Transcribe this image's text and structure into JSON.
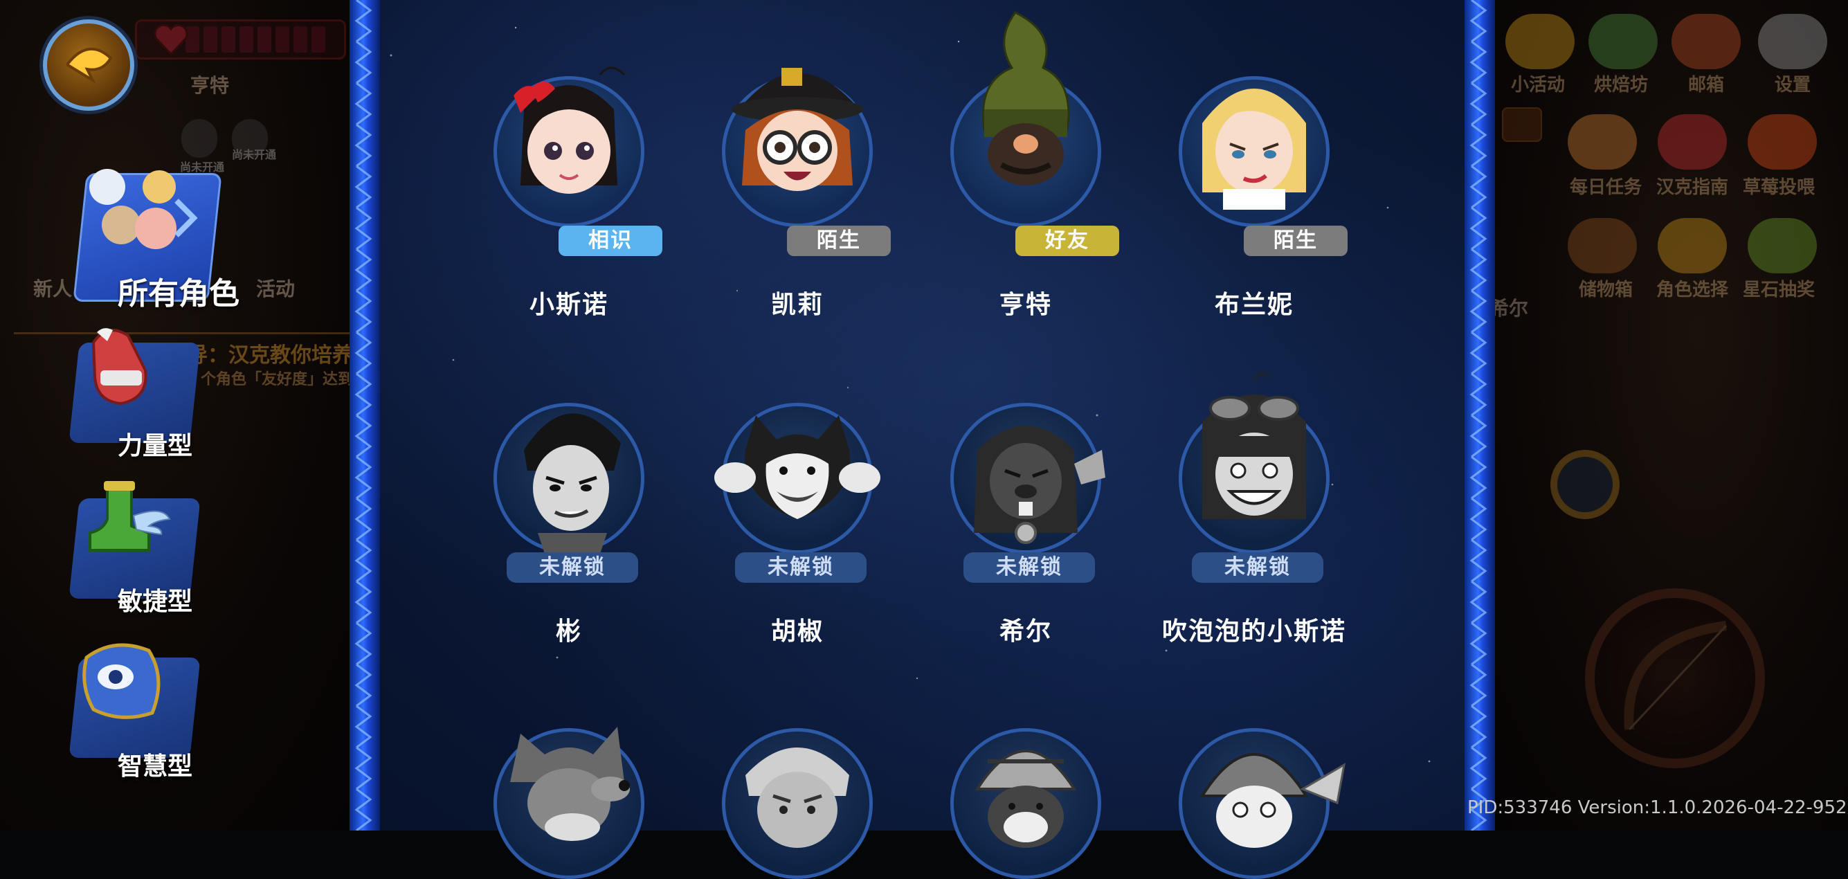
{
  "hud_left": {
    "player_name": "亨特",
    "tiny_faces": [
      "尚未开通",
      "尚未开通"
    ],
    "new_label": "新人",
    "event_label": "活动",
    "quest_title": "导：汉克教你培养",
    "quest_desc": "个角色「友好度」达到"
  },
  "hud_right": {
    "top_buttons": [
      "小活动",
      "烘焙坊",
      "邮箱",
      "设置"
    ],
    "mid_buttons": [
      "每日任务",
      "汉克指南",
      "草莓投喂"
    ],
    "low_buttons": [
      "储物箱",
      "角色选择",
      "星石抽奖"
    ],
    "npc_name": "希尔"
  },
  "categories": [
    {
      "label": "所有角色",
      "icon": "all-characters-icon",
      "active": true
    },
    {
      "label": "力量型",
      "icon": "glove-icon",
      "active": false
    },
    {
      "label": "敏捷型",
      "icon": "winged-boot-icon",
      "active": false
    },
    {
      "label": "智慧型",
      "icon": "eye-helmet-icon",
      "active": false
    }
  ],
  "characters": [
    {
      "name": "小斯诺",
      "badge": "相识",
      "status": "acquainted"
    },
    {
      "name": "凯莉",
      "badge": "陌生",
      "status": "stranger"
    },
    {
      "name": "亨特",
      "badge": "好友",
      "status": "friend"
    },
    {
      "name": "布兰妮",
      "badge": "陌生",
      "status": "stranger"
    },
    {
      "name": "彬",
      "badge": "未解锁",
      "status": "locked"
    },
    {
      "name": "胡椒",
      "badge": "未解锁",
      "status": "locked"
    },
    {
      "name": "希尔",
      "badge": "未解锁",
      "status": "locked"
    },
    {
      "name": "吹泡泡的小斯诺",
      "badge": "未解锁",
      "status": "locked"
    },
    {
      "name": "",
      "badge": "",
      "status": "locked"
    },
    {
      "name": "",
      "badge": "",
      "status": "locked"
    },
    {
      "name": "",
      "badge": "",
      "status": "locked"
    },
    {
      "name": "",
      "badge": "",
      "status": "locked"
    }
  ],
  "footer": {
    "version_text": "PID:533746  Version:1.1.0.2026-04-22-952"
  },
  "colors": {
    "panel_bg": "#0c1a38",
    "border_blue": "#2f6dff",
    "badge_acquainted": "#5ab4f0",
    "badge_stranger": "#7c7c7c",
    "badge_friend": "#c8b436",
    "badge_locked": "#2c4f88"
  }
}
